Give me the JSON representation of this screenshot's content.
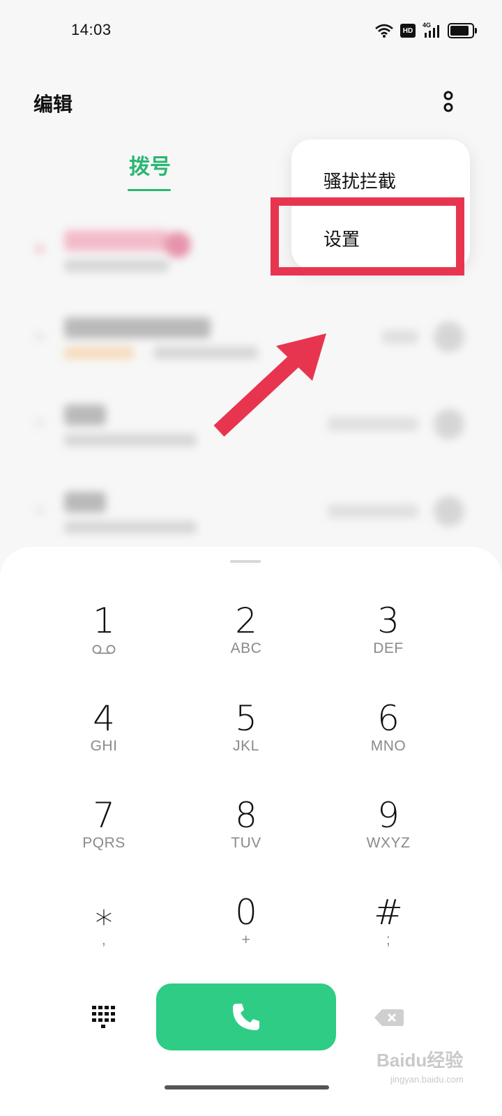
{
  "status_bar": {
    "time": "14:03",
    "hd": "HD",
    "network": "4G"
  },
  "header": {
    "edit_label": "编辑",
    "tab_dial": "拨号"
  },
  "menu": {
    "items": [
      "骚扰拦截",
      "设置"
    ]
  },
  "colors": {
    "accent_green": "#2bb673",
    "call_button": "#2ecc85",
    "annotation_red": "#e8354f"
  },
  "dialpad": {
    "keys": [
      {
        "num": "1",
        "sub": ""
      },
      {
        "num": "2",
        "sub": "ABC"
      },
      {
        "num": "3",
        "sub": "DEF"
      },
      {
        "num": "4",
        "sub": "GHI"
      },
      {
        "num": "5",
        "sub": "JKL"
      },
      {
        "num": "6",
        "sub": "MNO"
      },
      {
        "num": "7",
        "sub": "PQRS"
      },
      {
        "num": "8",
        "sub": "TUV"
      },
      {
        "num": "9",
        "sub": "WXYZ"
      },
      {
        "num": "⁎",
        "sub": ","
      },
      {
        "num": "0",
        "sub": "+"
      },
      {
        "num": "#",
        "sub": ";"
      }
    ]
  },
  "icons": {
    "voicemail": "voicemail-icon",
    "dialpad_toggle": "dialpad-grid-icon",
    "call": "phone-icon",
    "backspace": "backspace-icon"
  },
  "watermark": {
    "brand": "Baidu经验",
    "url": "jingyan.baidu.com"
  }
}
